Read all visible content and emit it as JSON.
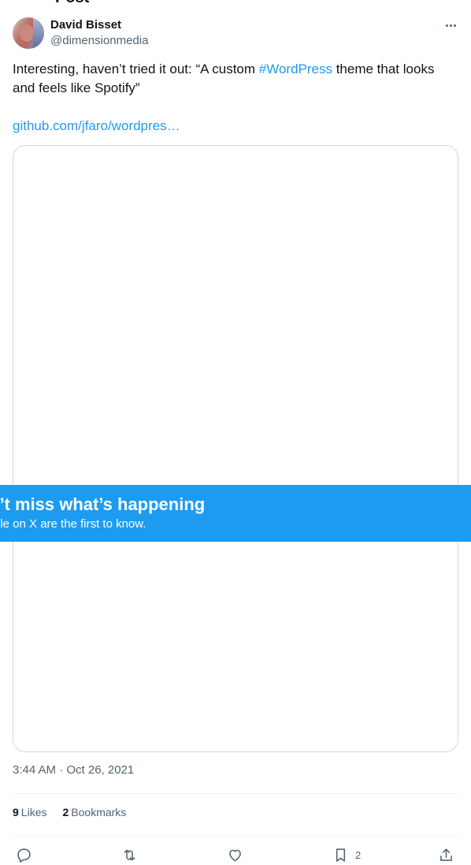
{
  "page_title": "Post",
  "author": {
    "name": "David Bisset",
    "handle": "@dimensionmedia"
  },
  "tweet": {
    "text_before": "Interesting, haven’t tried it out: “A custom ",
    "hashtag": "#WordPress",
    "text_after": " theme that looks and feels like Spotify”",
    "url": "github.com/jfaro/wordpres…"
  },
  "banner": {
    "title": "n’t miss what’s happening",
    "subtitle": "ble on X are the first to know."
  },
  "timestamp": "3:44 AM · Oct 26, 2021",
  "stats": {
    "likes_count": "9",
    "likes_label": "Likes",
    "bookmarks_count": "2",
    "bookmarks_label": "Bookmarks"
  },
  "actions": {
    "reply": "",
    "repost": "",
    "like": "",
    "bookmark": "2",
    "share": ""
  },
  "icons": [
    "more-icon",
    "reply-icon",
    "repost-icon",
    "like-icon",
    "bookmark-icon",
    "share-icon"
  ],
  "colors": {
    "accent": "#1d9bf0",
    "text": "#0f1419",
    "muted": "#536471",
    "border": "#cfd9de"
  }
}
